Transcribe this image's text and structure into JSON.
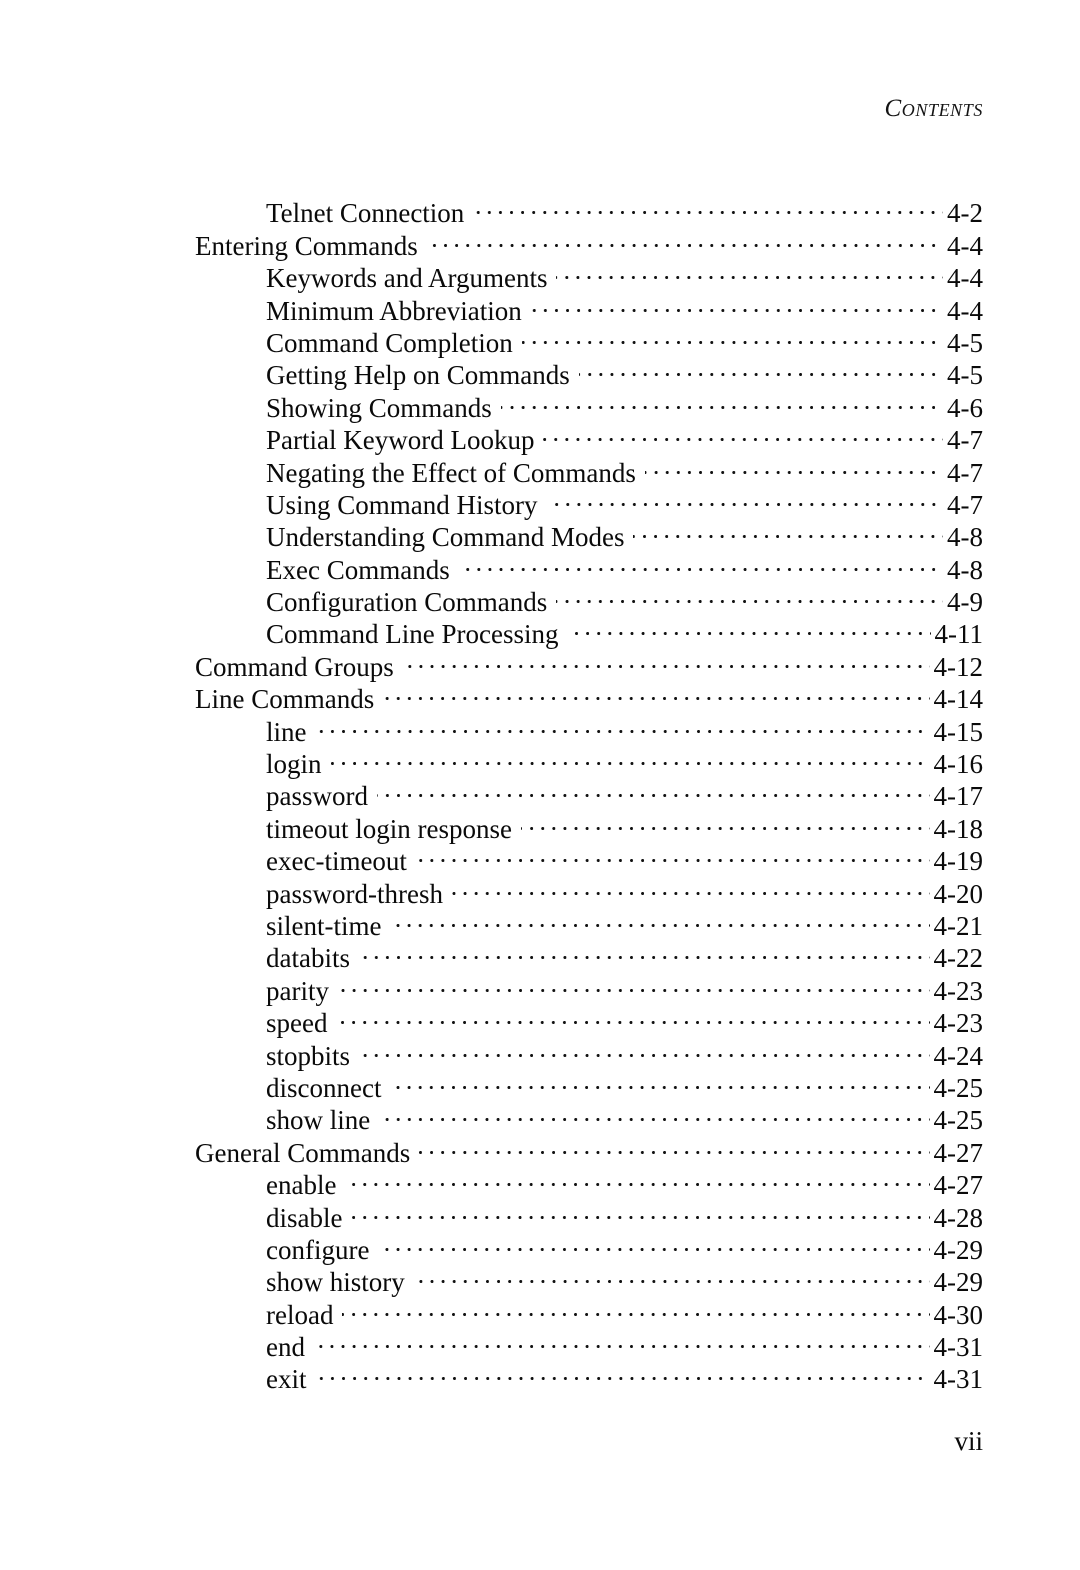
{
  "header": {
    "running_head": "Contents"
  },
  "folio": {
    "page_number": "vii"
  },
  "toc": {
    "entries": [
      {
        "title": "Telnet Connection",
        "page": "4-2",
        "level": 2
      },
      {
        "title": "Entering Commands",
        "page": "4-4",
        "level": 1
      },
      {
        "title": "Keywords and Arguments",
        "page": "4-4",
        "level": 2
      },
      {
        "title": "Minimum Abbreviation",
        "page": "4-4",
        "level": 2
      },
      {
        "title": "Command Completion",
        "page": "4-5",
        "level": 2
      },
      {
        "title": "Getting Help on Commands",
        "page": "4-5",
        "level": 2
      },
      {
        "title": "Showing Commands",
        "page": "4-6",
        "level": 2
      },
      {
        "title": "Partial Keyword Lookup",
        "page": "4-7",
        "level": 2
      },
      {
        "title": "Negating the Effect of Commands",
        "page": "4-7",
        "level": 2
      },
      {
        "title": "Using Command History",
        "page": "4-7",
        "level": 2
      },
      {
        "title": "Understanding Command Modes",
        "page": "4-8",
        "level": 2
      },
      {
        "title": "Exec Commands",
        "page": "4-8",
        "level": 2
      },
      {
        "title": "Configuration Commands",
        "page": "4-9",
        "level": 2
      },
      {
        "title": "Command Line Processing",
        "page": "4-11",
        "level": 2
      },
      {
        "title": "Command Groups",
        "page": "4-12",
        "level": 1
      },
      {
        "title": "Line Commands",
        "page": "4-14",
        "level": 1
      },
      {
        "title": "line",
        "page": "4-15",
        "level": 2
      },
      {
        "title": "login",
        "page": "4-16",
        "level": 2
      },
      {
        "title": "password",
        "page": "4-17",
        "level": 2
      },
      {
        "title": "timeout login response",
        "page": "4-18",
        "level": 2
      },
      {
        "title": "exec-timeout",
        "page": "4-19",
        "level": 2
      },
      {
        "title": "password-thresh",
        "page": "4-20",
        "level": 2
      },
      {
        "title": "silent-time",
        "page": "4-21",
        "level": 2
      },
      {
        "title": "databits",
        "page": "4-22",
        "level": 2
      },
      {
        "title": "parity",
        "page": "4-23",
        "level": 2
      },
      {
        "title": "speed",
        "page": "4-23",
        "level": 2
      },
      {
        "title": "stopbits",
        "page": "4-24",
        "level": 2
      },
      {
        "title": "disconnect",
        "page": "4-25",
        "level": 2
      },
      {
        "title": "show line",
        "page": "4-25",
        "level": 2
      },
      {
        "title": "General Commands",
        "page": "4-27",
        "level": 1
      },
      {
        "title": "enable",
        "page": "4-27",
        "level": 2
      },
      {
        "title": "disable",
        "page": "4-28",
        "level": 2
      },
      {
        "title": "configure",
        "page": "4-29",
        "level": 2
      },
      {
        "title": "show history",
        "page": "4-29",
        "level": 2
      },
      {
        "title": "reload",
        "page": "4-30",
        "level": 2
      },
      {
        "title": "end",
        "page": "4-31",
        "level": 2
      },
      {
        "title": "exit",
        "page": "4-31",
        "level": 2
      }
    ]
  }
}
